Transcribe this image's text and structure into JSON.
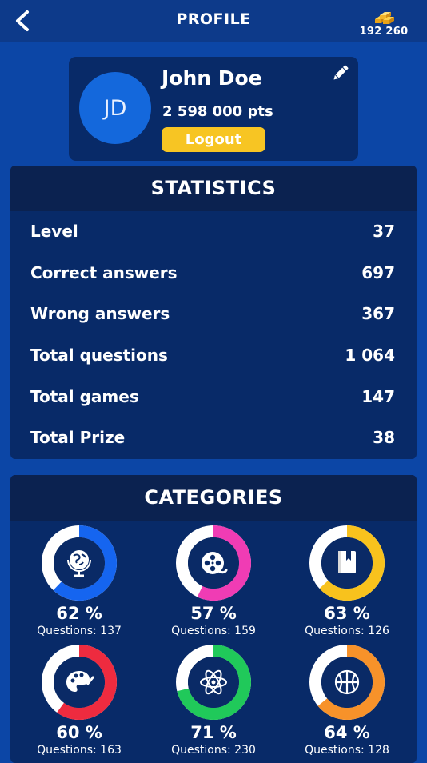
{
  "header": {
    "title": "PROFILE",
    "coins": "192 260",
    "back_icon": "chevron-left-icon",
    "coin_icon": "gold-bars-icon"
  },
  "profile": {
    "initials": "JD",
    "name": "John Doe",
    "points": "2 598 000 pts",
    "logout_label": "Logout",
    "edit_icon": "pencil-icon"
  },
  "statistics": {
    "title": "STATISTICS",
    "rows": [
      {
        "label": "Level",
        "value": "37"
      },
      {
        "label": "Correct answers",
        "value": "697"
      },
      {
        "label": "Wrong answers",
        "value": "367"
      },
      {
        "label": "Total questions",
        "value": "1 064"
      },
      {
        "label": "Total games",
        "value": "147"
      },
      {
        "label": "Total Prize",
        "value": "38"
      }
    ]
  },
  "categories": {
    "title": "CATEGORIES",
    "items": [
      {
        "icon": "globe-icon",
        "percent_value": 62,
        "percent": "62 %",
        "questions": "Questions: 137",
        "color": "#1565f0"
      },
      {
        "icon": "film-reel-icon",
        "percent_value": 57,
        "percent": "57 %",
        "questions": "Questions: 159",
        "color": "#f03cb4"
      },
      {
        "icon": "book-icon",
        "percent_value": 63,
        "percent": "63 %",
        "questions": "Questions: 126",
        "color": "#f8c21d"
      },
      {
        "icon": "palette-icon",
        "percent_value": 60,
        "percent": "60 %",
        "questions": "Questions: 163",
        "color": "#ee2b3f"
      },
      {
        "icon": "atom-icon",
        "percent_value": 71,
        "percent": "71 %",
        "questions": "Questions: 230",
        "color": "#20c95a"
      },
      {
        "icon": "basketball-icon",
        "percent_value": 64,
        "percent": "64 %",
        "questions": "Questions: 128",
        "color": "#f7922a"
      }
    ]
  },
  "colors": {
    "background": "#0c46a6",
    "card": "#082a68",
    "header": "#0b2250",
    "accent_yellow": "#f7c523",
    "avatar": "#1468dc"
  }
}
